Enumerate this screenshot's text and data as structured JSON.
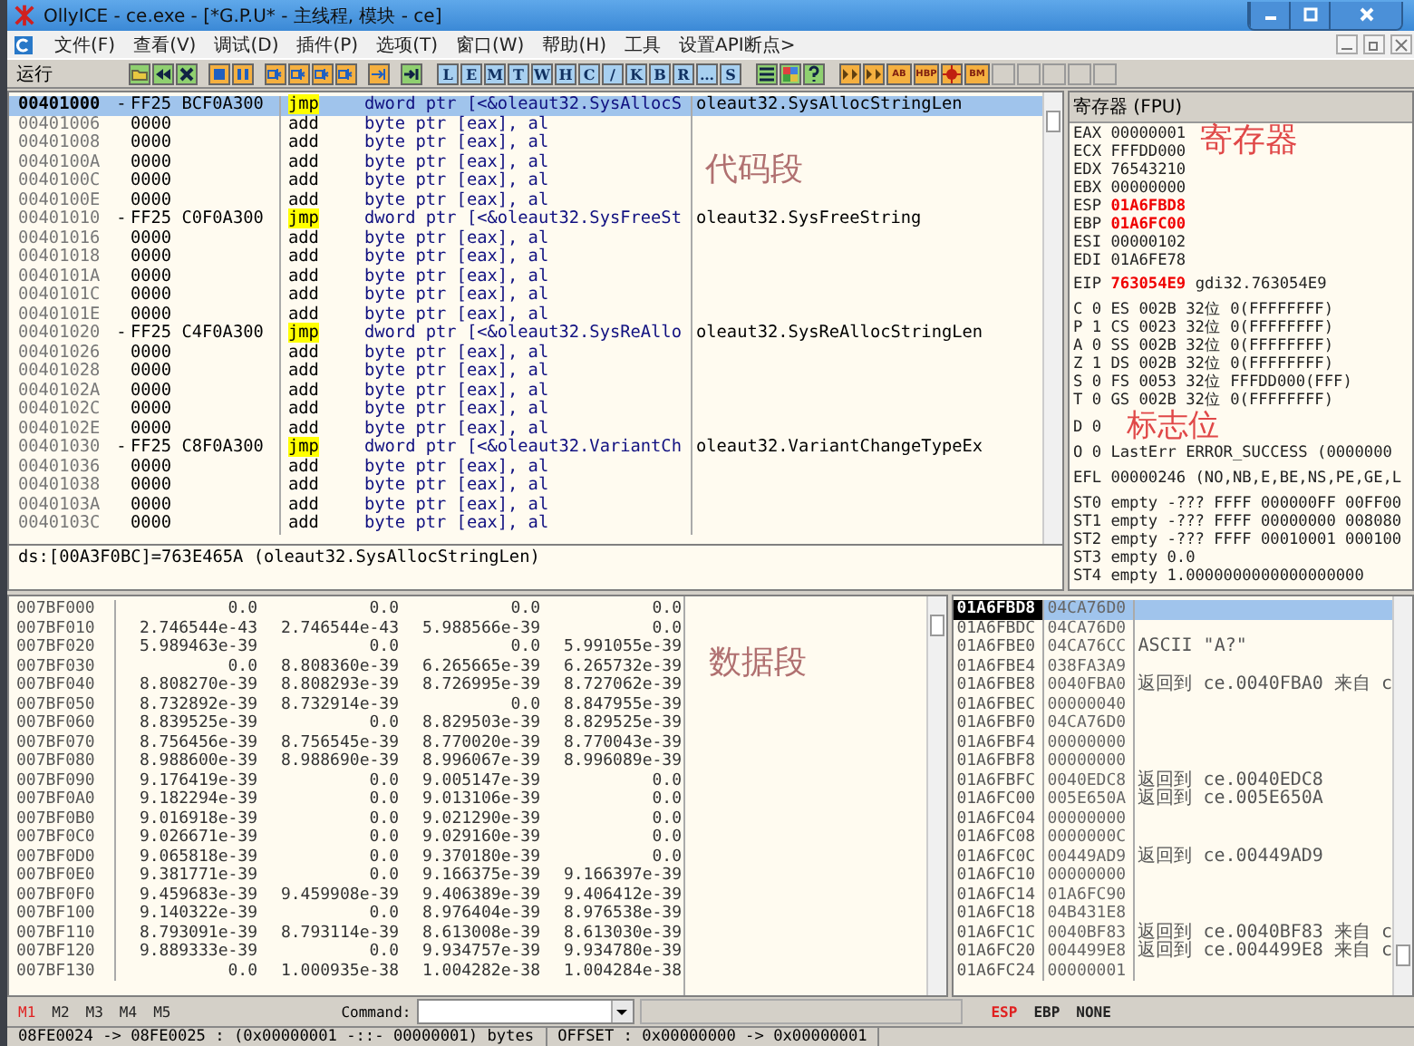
{
  "window": {
    "title": "OllyICE - ce.exe - [*G.P.U* - 主线程, 模块 - ce]"
  },
  "menu": [
    "文件(F)",
    "查看(V)",
    "调试(D)",
    "插件(P)",
    "选项(T)",
    "窗口(W)",
    "帮助(H)",
    "工具",
    "设置API断点>"
  ],
  "toolbar": {
    "status": "运行",
    "debug_buttons": [
      {
        "kind": "folder"
      },
      {
        "kind": "rewind"
      },
      {
        "kind": "close"
      },
      {
        "kind": "play"
      },
      {
        "kind": "pause"
      },
      {
        "kind": "step"
      },
      {
        "kind": "step"
      },
      {
        "kind": "step"
      },
      {
        "kind": "step"
      },
      {
        "kind": "return"
      },
      {
        "kind": "goto"
      }
    ],
    "view_buttons": [
      "L",
      "E",
      "M",
      "T",
      "W",
      "H",
      "C",
      "/",
      "K",
      "B",
      "R",
      "…",
      "S"
    ],
    "tool_buttons": [
      {
        "kind": "list"
      },
      {
        "kind": "grid"
      },
      {
        "kind": "help"
      }
    ],
    "plugin_buttons": [
      {
        "kind": "icon"
      },
      {
        "kind": "icon"
      },
      {
        "kind": "text",
        "label": "AB"
      },
      {
        "kind": "text",
        "label": "HBP"
      },
      {
        "kind": "burst"
      },
      {
        "kind": "text",
        "label": "BM"
      }
    ]
  },
  "code": {
    "annotation": "代码段",
    "rows": [
      {
        "address": "00401000",
        "marker": "-",
        "hex": "FF25 BCF0A300",
        "mnemonic": "jmp",
        "jump": true,
        "operand": "dword ptr [<&oleaut32.SysAllocS",
        "comment": "oleaut32.SysAllocStringLen",
        "selected": true
      },
      {
        "address": "00401006",
        "hex": "0000",
        "mnemonic": "add",
        "jump": false,
        "operand": "byte ptr [eax], al",
        "selected": false
      },
      {
        "address": "00401008",
        "hex": "0000",
        "mnemonic": "add",
        "jump": false,
        "operand": "byte ptr [eax], al",
        "selected": false
      },
      {
        "address": "0040100A",
        "hex": "0000",
        "mnemonic": "add",
        "jump": false,
        "operand": "byte ptr [eax], al",
        "selected": false
      },
      {
        "address": "0040100C",
        "hex": "0000",
        "mnemonic": "add",
        "jump": false,
        "operand": "byte ptr [eax], al",
        "selected": false
      },
      {
        "address": "0040100E",
        "hex": "0000",
        "mnemonic": "add",
        "jump": false,
        "operand": "byte ptr [eax], al",
        "selected": false
      },
      {
        "address": "00401010",
        "marker": "-",
        "hex": "FF25 C0F0A300",
        "mnemonic": "jmp",
        "jump": true,
        "operand": "dword ptr [<&oleaut32.SysFreeSt",
        "comment": "oleaut32.SysFreeString",
        "selected": false
      },
      {
        "address": "00401016",
        "hex": "0000",
        "mnemonic": "add",
        "jump": false,
        "operand": "byte ptr [eax], al",
        "selected": false
      },
      {
        "address": "00401018",
        "hex": "0000",
        "mnemonic": "add",
        "jump": false,
        "operand": "byte ptr [eax], al",
        "selected": false
      },
      {
        "address": "0040101A",
        "hex": "0000",
        "mnemonic": "add",
        "jump": false,
        "operand": "byte ptr [eax], al",
        "selected": false
      },
      {
        "address": "0040101C",
        "hex": "0000",
        "mnemonic": "add",
        "jump": false,
        "operand": "byte ptr [eax], al",
        "selected": false
      },
      {
        "address": "0040101E",
        "hex": "0000",
        "mnemonic": "add",
        "jump": false,
        "operand": "byte ptr [eax], al",
        "selected": false
      },
      {
        "address": "00401020",
        "marker": "-",
        "hex": "FF25 C4F0A300",
        "mnemonic": "jmp",
        "jump": true,
        "operand": "dword ptr [<&oleaut32.SysReAllo",
        "comment": "oleaut32.SysReAllocStringLen",
        "selected": false
      },
      {
        "address": "00401026",
        "hex": "0000",
        "mnemonic": "add",
        "jump": false,
        "operand": "byte ptr [eax], al",
        "selected": false
      },
      {
        "address": "00401028",
        "hex": "0000",
        "mnemonic": "add",
        "jump": false,
        "operand": "byte ptr [eax], al",
        "selected": false
      },
      {
        "address": "0040102A",
        "hex": "0000",
        "mnemonic": "add",
        "jump": false,
        "operand": "byte ptr [eax], al",
        "selected": false
      },
      {
        "address": "0040102C",
        "hex": "0000",
        "mnemonic": "add",
        "jump": false,
        "operand": "byte ptr [eax], al",
        "selected": false
      },
      {
        "address": "0040102E",
        "hex": "0000",
        "mnemonic": "add",
        "jump": false,
        "operand": "byte ptr [eax], al",
        "selected": false
      },
      {
        "address": "00401030",
        "marker": "-",
        "hex": "FF25 C8F0A300",
        "mnemonic": "jmp",
        "jump": true,
        "operand": "dword ptr [<&oleaut32.VariantCh",
        "comment": "oleaut32.VariantChangeTypeEx",
        "selected": false
      },
      {
        "address": "00401036",
        "hex": "0000",
        "mnemonic": "add",
        "jump": false,
        "operand": "byte ptr [eax], al",
        "selected": false
      },
      {
        "address": "00401038",
        "hex": "0000",
        "mnemonic": "add",
        "jump": false,
        "operand": "byte ptr [eax], al",
        "selected": false
      },
      {
        "address": "0040103A",
        "hex": "0000",
        "mnemonic": "add",
        "jump": false,
        "operand": "byte ptr [eax], al",
        "selected": false
      },
      {
        "address": "0040103C",
        "hex": "0000",
        "mnemonic": "add",
        "jump": false,
        "operand": "byte ptr [eax], al",
        "selected": false
      }
    ]
  },
  "info_line": "ds:[00A3F0BC]=763E465A (oleaut32.SysAllocStringLen)",
  "registers": {
    "title": "寄存器 (FPU)",
    "annotation": "寄存器",
    "flags_annotation": "标志位",
    "general": [
      {
        "name": "EAX",
        "value": "00000001",
        "changed": false
      },
      {
        "name": "ECX",
        "value": "FFFDD000",
        "changed": false
      },
      {
        "name": "EDX",
        "value": "76543210",
        "changed": false
      },
      {
        "name": "EBX",
        "value": "00000000",
        "changed": false
      },
      {
        "name": "ESP",
        "value": "01A6FBD8",
        "changed": true
      },
      {
        "name": "EBP",
        "value": "01A6FC00",
        "changed": true
      },
      {
        "name": "ESI",
        "value": "00000102",
        "changed": false
      },
      {
        "name": "EDI",
        "value": "01A6FE78",
        "changed": false
      }
    ],
    "eip": {
      "name": "EIP",
      "value": "763054E9",
      "changed": true,
      "comment": "gdi32.763054E9"
    },
    "flags": [
      "C 0  ES 002B 32位 0(FFFFFFFF)",
      "P 1  CS 0023 32位 0(FFFFFFFF)",
      "A 0  SS 002B 32位 0(FFFFFFFF)",
      "Z 1  DS 002B 32位 0(FFFFFFFF)",
      "S 0  FS 0053 32位 FFFDD000(FFF)",
      "T 0  GS 002B 32位 0(FFFFFFFF)",
      "D 0",
      "O 0  LastErr ERROR_SUCCESS (0000000"
    ],
    "efl": "EFL 00000246 (NO,NB,E,BE,NS,PE,GE,L",
    "fpu": [
      "ST0 empty -??? FFFF 000000FF 00FF00",
      "ST1 empty -??? FFFF 00000000 008080",
      "ST2 empty -??? FFFF 00010001 000100",
      "ST3 empty 0.0",
      "ST4 empty 1.0000000000000000000"
    ]
  },
  "dump": {
    "annotation": "数据段",
    "rows": [
      {
        "address": "007BF000",
        "values": [
          "0.0",
          "0.0",
          "0.0",
          "0.0"
        ]
      },
      {
        "address": "007BF010",
        "values": [
          "2.746544e-43",
          "2.746544e-43",
          "5.988566e-39",
          "0.0"
        ]
      },
      {
        "address": "007BF020",
        "values": [
          "5.989463e-39",
          "0.0",
          "0.0",
          "5.991055e-39"
        ]
      },
      {
        "address": "007BF030",
        "values": [
          "0.0",
          "8.808360e-39",
          "6.265665e-39",
          "6.265732e-39"
        ]
      },
      {
        "address": "007BF040",
        "values": [
          "8.808270e-39",
          "8.808293e-39",
          "8.726995e-39",
          "8.727062e-39"
        ]
      },
      {
        "address": "007BF050",
        "values": [
          "8.732892e-39",
          "8.732914e-39",
          "0.0",
          "8.847955e-39"
        ]
      },
      {
        "address": "007BF060",
        "values": [
          "8.839525e-39",
          "0.0",
          "8.829503e-39",
          "8.829525e-39"
        ]
      },
      {
        "address": "007BF070",
        "values": [
          "8.756456e-39",
          "8.756545e-39",
          "8.770020e-39",
          "8.770043e-39"
        ]
      },
      {
        "address": "007BF080",
        "values": [
          "8.988600e-39",
          "8.988690e-39",
          "8.996067e-39",
          "8.996089e-39"
        ]
      },
      {
        "address": "007BF090",
        "values": [
          "9.176419e-39",
          "0.0",
          "9.005147e-39",
          "0.0"
        ]
      },
      {
        "address": "007BF0A0",
        "values": [
          "9.182294e-39",
          "0.0",
          "9.013106e-39",
          "0.0"
        ]
      },
      {
        "address": "007BF0B0",
        "values": [
          "9.016918e-39",
          "0.0",
          "9.021290e-39",
          "0.0"
        ]
      },
      {
        "address": "007BF0C0",
        "values": [
          "9.026671e-39",
          "0.0",
          "9.029160e-39",
          "0.0"
        ]
      },
      {
        "address": "007BF0D0",
        "values": [
          "9.065818e-39",
          "0.0",
          "9.370180e-39",
          "0.0"
        ]
      },
      {
        "address": "007BF0E0",
        "values": [
          "9.381771e-39",
          "0.0",
          "9.166375e-39",
          "9.166397e-39"
        ]
      },
      {
        "address": "007BF0F0",
        "values": [
          "9.459683e-39",
          "9.459908e-39",
          "9.406389e-39",
          "9.406412e-39"
        ]
      },
      {
        "address": "007BF100",
        "values": [
          "9.140322e-39",
          "0.0",
          "8.976404e-39",
          "8.976538e-39"
        ]
      },
      {
        "address": "007BF110",
        "values": [
          "8.793091e-39",
          "8.793114e-39",
          "8.613008e-39",
          "8.613030e-39"
        ]
      },
      {
        "address": "007BF120",
        "values": [
          "9.889333e-39",
          "0.0",
          "9.934757e-39",
          "9.934780e-39"
        ]
      },
      {
        "address": "007BF130",
        "values": [
          "0.0",
          "1.000935e-38",
          "1.004282e-38",
          "1.004284e-38"
        ]
      }
    ]
  },
  "stack": {
    "rows": [
      {
        "address": "01A6FBD8",
        "value": "04CA76D0",
        "selected": true
      },
      {
        "address": "01A6FBDC",
        "value": "04CA76D0",
        "selected": false
      },
      {
        "address": "01A6FBE0",
        "value": "04CA76CC",
        "comment": "ASCII \"A?\"",
        "selected": false
      },
      {
        "address": "01A6FBE4",
        "value": "038FA3A9",
        "selected": false
      },
      {
        "address": "01A6FBE8",
        "value": "0040FBA0",
        "comment": "返回到 ce.0040FBA0 来自 c",
        "selected": false
      },
      {
        "address": "01A6FBEC",
        "value": "00000040",
        "selected": false
      },
      {
        "address": "01A6FBF0",
        "value": "04CA76D0",
        "selected": false
      },
      {
        "address": "01A6FBF4",
        "value": "00000000",
        "selected": false
      },
      {
        "address": "01A6FBF8",
        "value": "00000000",
        "selected": false
      },
      {
        "address": "01A6FBFC",
        "value": "0040EDC8",
        "comment": "返回到 ce.0040EDC8",
        "selected": false
      },
      {
        "address": "01A6FC00",
        "value": "005E650A",
        "comment": "返回到 ce.005E650A",
        "selected": false
      },
      {
        "address": "01A6FC04",
        "value": "00000000",
        "selected": false
      },
      {
        "address": "01A6FC08",
        "value": "0000000C",
        "selected": false
      },
      {
        "address": "01A6FC0C",
        "value": "00449AD9",
        "comment": "返回到 ce.00449AD9",
        "selected": false
      },
      {
        "address": "01A6FC10",
        "value": "00000000",
        "selected": false
      },
      {
        "address": "01A6FC14",
        "value": "01A6FC90",
        "selected": false
      },
      {
        "address": "01A6FC18",
        "value": "04B431E8",
        "selected": false
      },
      {
        "address": "01A6FC1C",
        "value": "0040BF83",
        "comment": "返回到 ce.0040BF83 来自 c",
        "selected": false
      },
      {
        "address": "01A6FC20",
        "value": "004499E8",
        "comment": "返回到 ce.004499E8 来自 c",
        "selected": false
      },
      {
        "address": "01A6FC24",
        "value": "00000001",
        "selected": false
      }
    ]
  },
  "bottom_bar": {
    "memory_tabs": [
      {
        "label": "M1",
        "selected": true
      },
      {
        "label": "M2",
        "selected": false
      },
      {
        "label": "M3",
        "selected": false
      },
      {
        "label": "M4",
        "selected": false
      },
      {
        "label": "M5",
        "selected": false
      }
    ],
    "command_label": "Command:",
    "stack_modes": [
      {
        "label": "ESP",
        "selected": true
      },
      {
        "label": "EBP",
        "selected": false
      },
      {
        "label": "NONE",
        "selected": false
      }
    ]
  },
  "status_bar": [
    "08FE0024 -> 08FE0025 : (0x00000001  -::-  00000001) bytes",
    "OFFSET : 0x00000000 -> 0x00000001"
  ]
}
